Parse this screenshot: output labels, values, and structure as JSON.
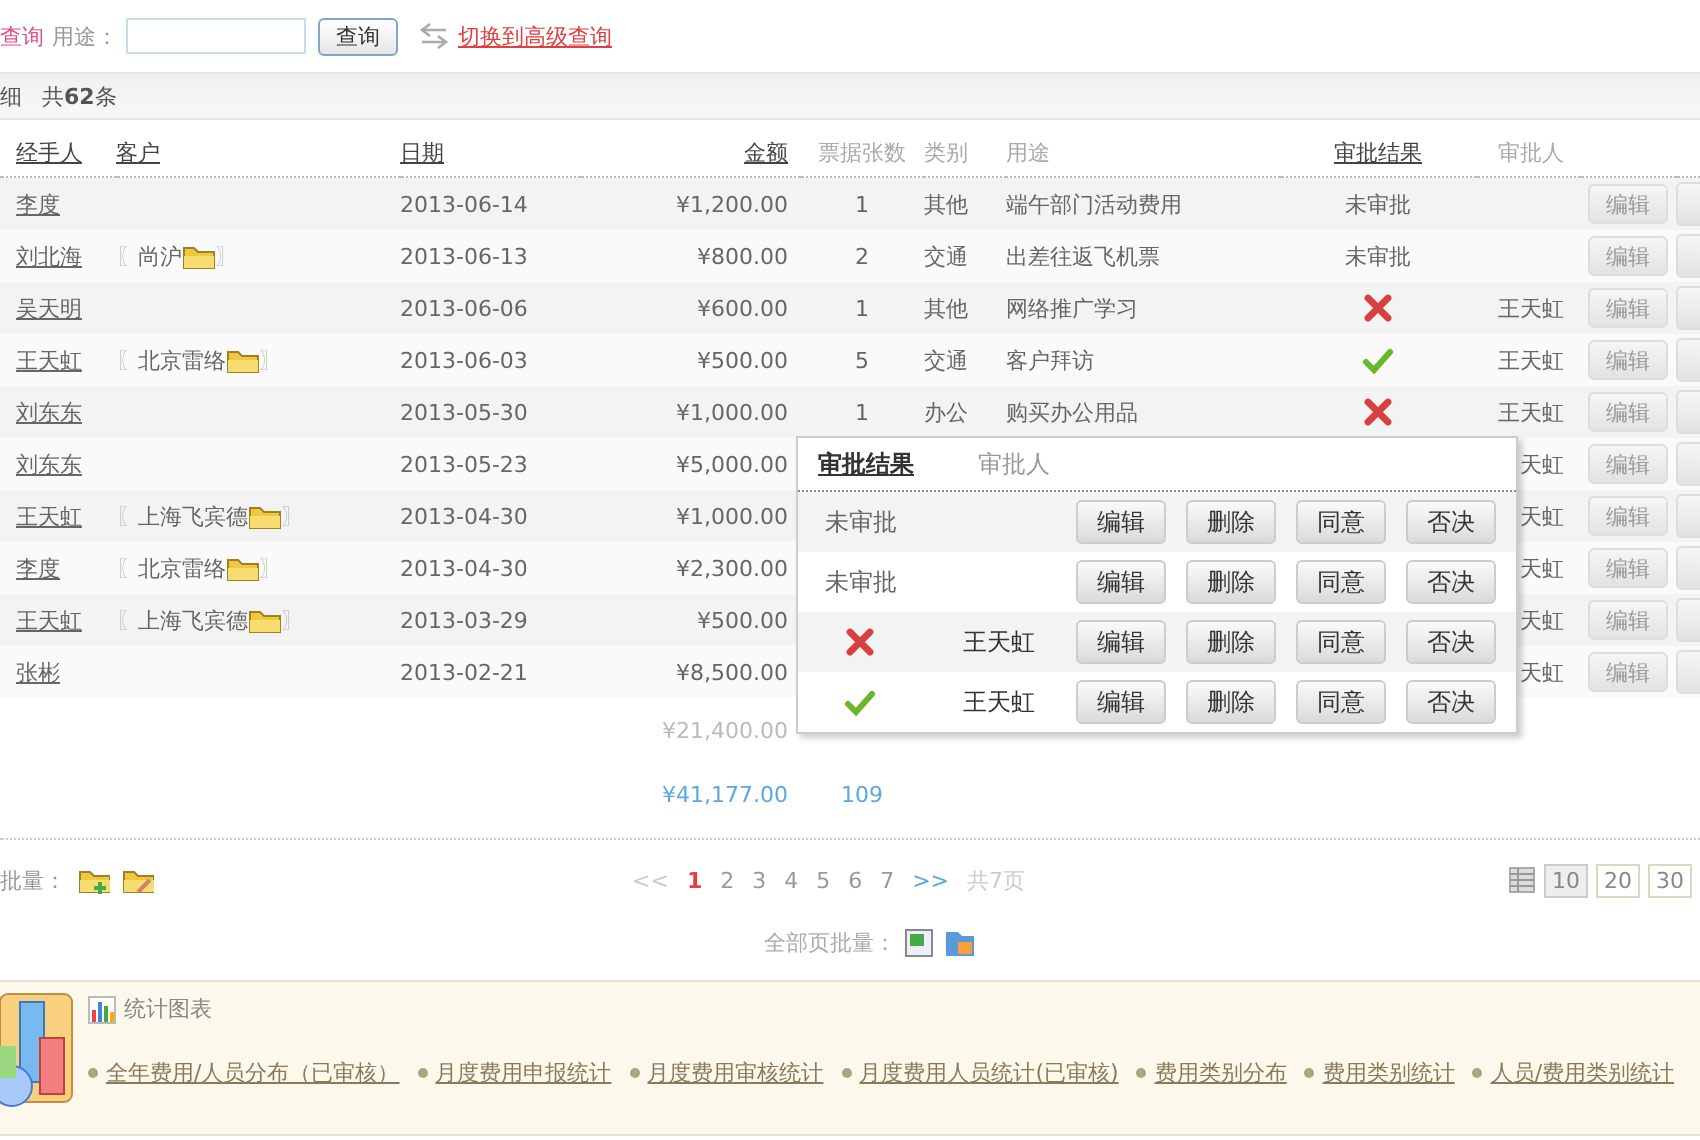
{
  "search": {
    "mode_label": "查询",
    "field_label": "用途：",
    "button": "查询",
    "advanced_link": "切换到高级查询"
  },
  "summary": {
    "title": "细",
    "count": "共**62**条"
  },
  "table": {
    "columns": [
      {
        "label": "经手人",
        "link": true
      },
      {
        "label": "客户",
        "link": true
      },
      {
        "label": "日期",
        "link": true
      },
      {
        "label": "金额",
        "link": true
      },
      {
        "label": "票据张数",
        "link": false
      },
      {
        "label": "类别",
        "link": false
      },
      {
        "label": "用途",
        "link": false
      },
      {
        "label": "审批结果",
        "link": true
      },
      {
        "label": "审批人",
        "link": false
      }
    ],
    "rows": [
      {
        "handler": "李度",
        "date": "2013-06-14",
        "amount": "¥1,200.00",
        "count": "1",
        "category": "其他",
        "purpose": "端午部门活动费用",
        "result": {
          "kind": "text",
          "text": "未审批"
        },
        "edit": "编辑"
      },
      {
        "handler": "刘北海",
        "client": {
          "name": "尚沪",
          "brackets": [
            "〖",
            "〗"
          ]
        },
        "date": "2013-06-13",
        "amount": "¥800.00",
        "count": "2",
        "category": "交通",
        "purpose": "出差往返飞机票",
        "result": {
          "kind": "text",
          "text": "未审批"
        },
        "edit": "编辑"
      },
      {
        "handler": "吴天明",
        "date": "2013-06-06",
        "amount": "¥600.00",
        "count": "1",
        "category": "其他",
        "purpose": "网络推广学习",
        "result": {
          "kind": "rejected"
        },
        "approver": "王天虹",
        "edit": "编辑"
      },
      {
        "handler": "王天虹",
        "client": {
          "name": "北京雷络",
          "brackets": [
            "〖",
            "〗"
          ]
        },
        "date": "2013-06-03",
        "amount": "¥500.00",
        "count": "5",
        "category": "交通",
        "purpose": "客户拜访",
        "result": {
          "kind": "approved"
        },
        "approver": "王天虹",
        "edit": "编辑"
      },
      {
        "handler": "刘东东",
        "date": "2013-05-30",
        "amount": "¥1,000.00",
        "count": "1",
        "category": "办公",
        "purpose": "购买办公用品",
        "result": {
          "kind": "rejected"
        },
        "approver": "王天虹",
        "edit": "编辑"
      },
      {
        "handler": "刘东东",
        "date": "2013-05-23",
        "amount": "¥5,000.00",
        "approver": "天虹",
        "edit": "编辑"
      },
      {
        "handler": "王天虹",
        "client": {
          "name": "上海飞宾德",
          "brackets": [
            "〖",
            "〗"
          ]
        },
        "date": "2013-04-30",
        "amount": "¥1,000.00",
        "approver": "天虹",
        "edit": "编辑"
      },
      {
        "handler": "李度",
        "client": {
          "name": "北京雷络",
          "brackets": [
            "〖",
            "〗"
          ]
        },
        "date": "2013-04-30",
        "amount": "¥2,300.00",
        "approver": "天虹",
        "edit": "编辑"
      },
      {
        "handler": "王天虹",
        "client": {
          "name": "上海飞宾德",
          "brackets": [
            "〖",
            "〗"
          ]
        },
        "date": "2013-03-29",
        "amount": "¥500.00",
        "approver": "天虹",
        "edit": "编辑"
      },
      {
        "handler": "张彬",
        "date": "2013-02-21",
        "amount": "¥8,500.00",
        "approver": "天虹",
        "edit": "编辑"
      }
    ],
    "totals": [
      {
        "kind": "page",
        "amount": "¥21,400.00"
      },
      {
        "kind": "all",
        "amount": "¥41,177.00",
        "count": "109"
      }
    ]
  },
  "popup": {
    "tabs": [
      {
        "label": "审批结果",
        "selected": true
      },
      {
        "label": "审批人",
        "selected": false
      }
    ],
    "rows": [
      {
        "result": {
          "kind": "text",
          "text": "未审批"
        },
        "buttons": [
          "编辑",
          "删除",
          "同意",
          "否决"
        ]
      },
      {
        "result": {
          "kind": "text",
          "text": "未审批"
        },
        "buttons": [
          "编辑",
          "删除",
          "同意",
          "否决"
        ]
      },
      {
        "result": {
          "kind": "rejected"
        },
        "approver": "王天虹",
        "buttons": [
          "编辑",
          "删除",
          "同意",
          "否决"
        ]
      },
      {
        "result": {
          "kind": "approved"
        },
        "approver": "王天虹",
        "buttons": [
          "编辑",
          "删除",
          "同意",
          "否决"
        ]
      }
    ]
  },
  "batch": {
    "label": "批量：",
    "all_label": "全部页批量："
  },
  "pagination": {
    "prev": "<<",
    "pages": [
      {
        "label": "1",
        "selected": true
      },
      {
        "label": "2",
        "selected": false
      },
      {
        "label": "3",
        "selected": false
      },
      {
        "label": "4",
        "selected": false
      },
      {
        "label": "5",
        "selected": false
      },
      {
        "label": "6",
        "selected": false
      },
      {
        "label": "7",
        "selected": false
      }
    ],
    "next": ">>",
    "total": "共7页",
    "sizes": [
      {
        "label": "10",
        "selected": true
      },
      {
        "label": "20",
        "selected": false
      },
      {
        "label": "30",
        "selected": false
      }
    ]
  },
  "stats": {
    "title": "统计图表",
    "links": [
      "全年费用/人员分布（已审核）",
      "月度费用申报统计",
      "月度费用审核统计",
      "月度费用人员统计(已审核)",
      "费用类别分布",
      "费用类别统计",
      "人员/费用类别统计"
    ]
  }
}
